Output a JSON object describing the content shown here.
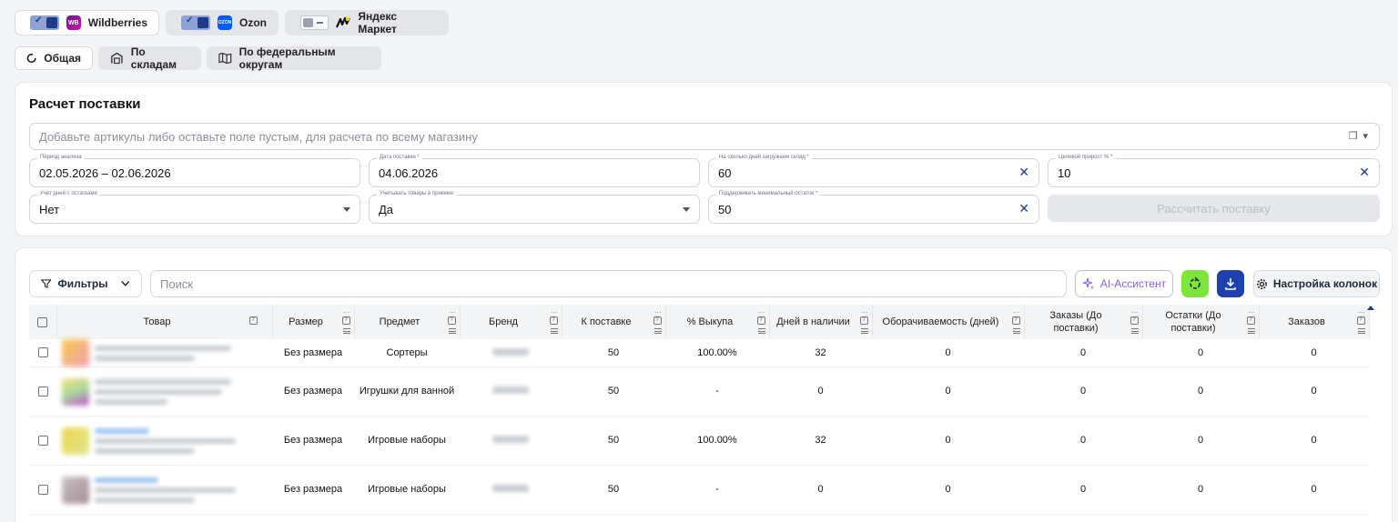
{
  "marketplaces": [
    {
      "name": "Wildberries",
      "logo": "WB",
      "enabled": true
    },
    {
      "name": "Ozon",
      "logo": "OZON",
      "enabled": true
    },
    {
      "name": "Яндекс Маркет",
      "logo": "yandex-market-icon",
      "enabled": false
    }
  ],
  "view_tabs": [
    {
      "label": "Общая",
      "icon": "donut-icon",
      "active": true
    },
    {
      "label": "По складам",
      "icon": "warehouse-icon",
      "active": false
    },
    {
      "label": "По федеральным округам",
      "icon": "map-icon",
      "active": false
    }
  ],
  "supply": {
    "title": "Расчет поставки",
    "articles_placeholder": "Добавьте артикулы либо оставьте поле пустым, для расчета по всему магазину",
    "fields": {
      "period": {
        "label": "Период анализа",
        "value": "02.05.2026 – 02.06.2026"
      },
      "supply_date": {
        "label": "Дата поставки *",
        "value": "04.06.2026"
      },
      "days_load": {
        "label": "На сколько дней загружаем склад *",
        "value": "60"
      },
      "growth": {
        "label": "Целевой прирост % *",
        "value": "10"
      },
      "stock_days": {
        "label": "Учет дней с остатками",
        "value": "Нет"
      },
      "in_transit": {
        "label": "Учитывать товары в приемке",
        "value": "Да"
      },
      "min_stock": {
        "label": "Поддерживать минимальный остаток *",
        "value": "50"
      }
    },
    "calc_button": "Рассчитать поставку"
  },
  "toolbar": {
    "filters_label": "Фильтры",
    "search_placeholder": "Поиск",
    "ai_label": "AI-Ассистент",
    "columns_label": "Настройка колонок"
  },
  "table": {
    "columns": [
      "Товар",
      "Размер",
      "Предмет",
      "Бренд",
      "К поставке",
      "% Выкупа",
      "Дней в наличии",
      "Оборачиваемость (дней)",
      "Заказы (До поставки)",
      "Остатки (До поставки)",
      "Заказов"
    ],
    "rows": [
      {
        "size": "Без размера",
        "subject": "Сортеры",
        "to_supply": "50",
        "buyout": "100.00%",
        "days": "32",
        "turnover": "0",
        "orders_before": "0",
        "stock_before": "0",
        "orders": "0"
      },
      {
        "size": "Без размера",
        "subject": "Игрушки для ванной",
        "to_supply": "50",
        "buyout": "-",
        "days": "0",
        "turnover": "0",
        "orders_before": "0",
        "stock_before": "0",
        "orders": "0"
      },
      {
        "size": "Без размера",
        "subject": "Игровые наборы",
        "to_supply": "50",
        "buyout": "100.00%",
        "days": "32",
        "turnover": "0",
        "orders_before": "0",
        "stock_before": "0",
        "orders": "0"
      },
      {
        "size": "Без размера",
        "subject": "Игровые наборы",
        "to_supply": "50",
        "buyout": "-",
        "days": "0",
        "turnover": "0",
        "orders_before": "0",
        "stock_before": "0",
        "orders": "0"
      }
    ]
  }
}
